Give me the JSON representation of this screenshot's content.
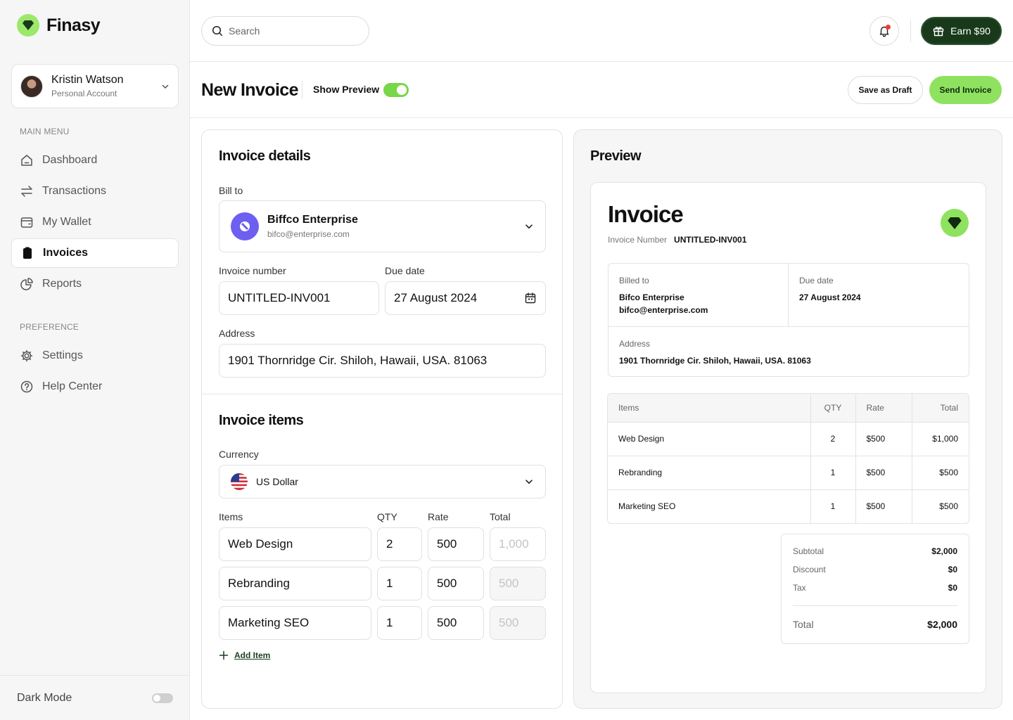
{
  "app": {
    "name": "Finasy"
  },
  "account": {
    "name": "Kristin Watson",
    "type": "Personal Account"
  },
  "sidebar": {
    "main_menu_label": "MAIN MENU",
    "preference_label": "PREFERENCE",
    "items": [
      {
        "label": "Dashboard",
        "icon": "home-icon"
      },
      {
        "label": "Transactions",
        "icon": "arrows-icon"
      },
      {
        "label": "My Wallet",
        "icon": "wallet-icon"
      },
      {
        "label": "Invoices",
        "icon": "clipboard-icon",
        "active": true
      },
      {
        "label": "Reports",
        "icon": "pie-chart-icon"
      }
    ],
    "pref_items": [
      {
        "label": "Settings",
        "icon": "gear-icon"
      },
      {
        "label": "Help Center",
        "icon": "help-icon"
      }
    ],
    "dark_mode_label": "Dark Mode",
    "dark_mode_on": false
  },
  "topbar": {
    "search_placeholder": "Search",
    "earn_label": "Earn $90",
    "has_notification": true
  },
  "page": {
    "title": "New Invoice",
    "show_preview_label": "Show Preview",
    "show_preview_on": true,
    "save_draft_label": "Save as Draft",
    "send_label": "Send Invoice"
  },
  "form": {
    "details_title": "Invoice details",
    "bill_to_label": "Bill to",
    "client_name": "Biffco Enterprise",
    "client_email": "bifco@enterprise.com",
    "invoice_number_label": "Invoice number",
    "invoice_number": "UNTITLED-INV001",
    "due_date_label": "Due date",
    "due_date": "27 August 2024",
    "address_label": "Address",
    "address": "1901 Thornridge Cir. Shiloh, Hawaii, USA. 81063",
    "items_title": "Invoice items",
    "currency_label": "Currency",
    "currency": "US Dollar",
    "col_items": "Items",
    "col_qty": "QTY",
    "col_rate": "Rate",
    "col_total": "Total",
    "items": [
      {
        "name": "Web Design",
        "qty": "2",
        "rate": "500",
        "total": "1,000"
      },
      {
        "name": "Rebranding",
        "qty": "1",
        "rate": "500",
        "total": "500"
      },
      {
        "name": "Marketing SEO",
        "qty": "1",
        "rate": "500",
        "total": "500"
      }
    ],
    "add_item_label": "Add Item"
  },
  "preview": {
    "title": "Preview",
    "invoice_title": "Invoice",
    "invoice_number_label": "Invoice Number",
    "invoice_number": "UNTITLED-INV001",
    "billed_to_label": "Billed to",
    "billed_to_name": "Bifco Enterprise",
    "billed_to_email": "bifco@enterprise.com",
    "due_date_label": "Due date",
    "due_date": "27 August 2024",
    "address_label": "Address",
    "address": "1901 Thornridge Cir. Shiloh, Hawaii, USA. 81063",
    "col_items": "Items",
    "col_qty": "QTY",
    "col_rate": "Rate",
    "col_total": "Total",
    "rows": [
      {
        "item": "Web Design",
        "qty": "2",
        "rate": "$500",
        "total": "$1,000"
      },
      {
        "item": "Rebranding",
        "qty": "1",
        "rate": "$500",
        "total": "$500"
      },
      {
        "item": "Marketing SEO",
        "qty": "1",
        "rate": "$500",
        "total": "$500"
      }
    ],
    "subtotal_label": "Subtotal",
    "subtotal": "$2,000",
    "discount_label": "Discount",
    "discount": "$0",
    "tax_label": "Tax",
    "tax": "$0",
    "total_label": "Total",
    "total": "$2,000"
  },
  "colors": {
    "accent": "#8fe25f",
    "dark_green": "#183a1b",
    "client_avatar": "#6d5ff0",
    "notification": "#ef3b3b"
  }
}
